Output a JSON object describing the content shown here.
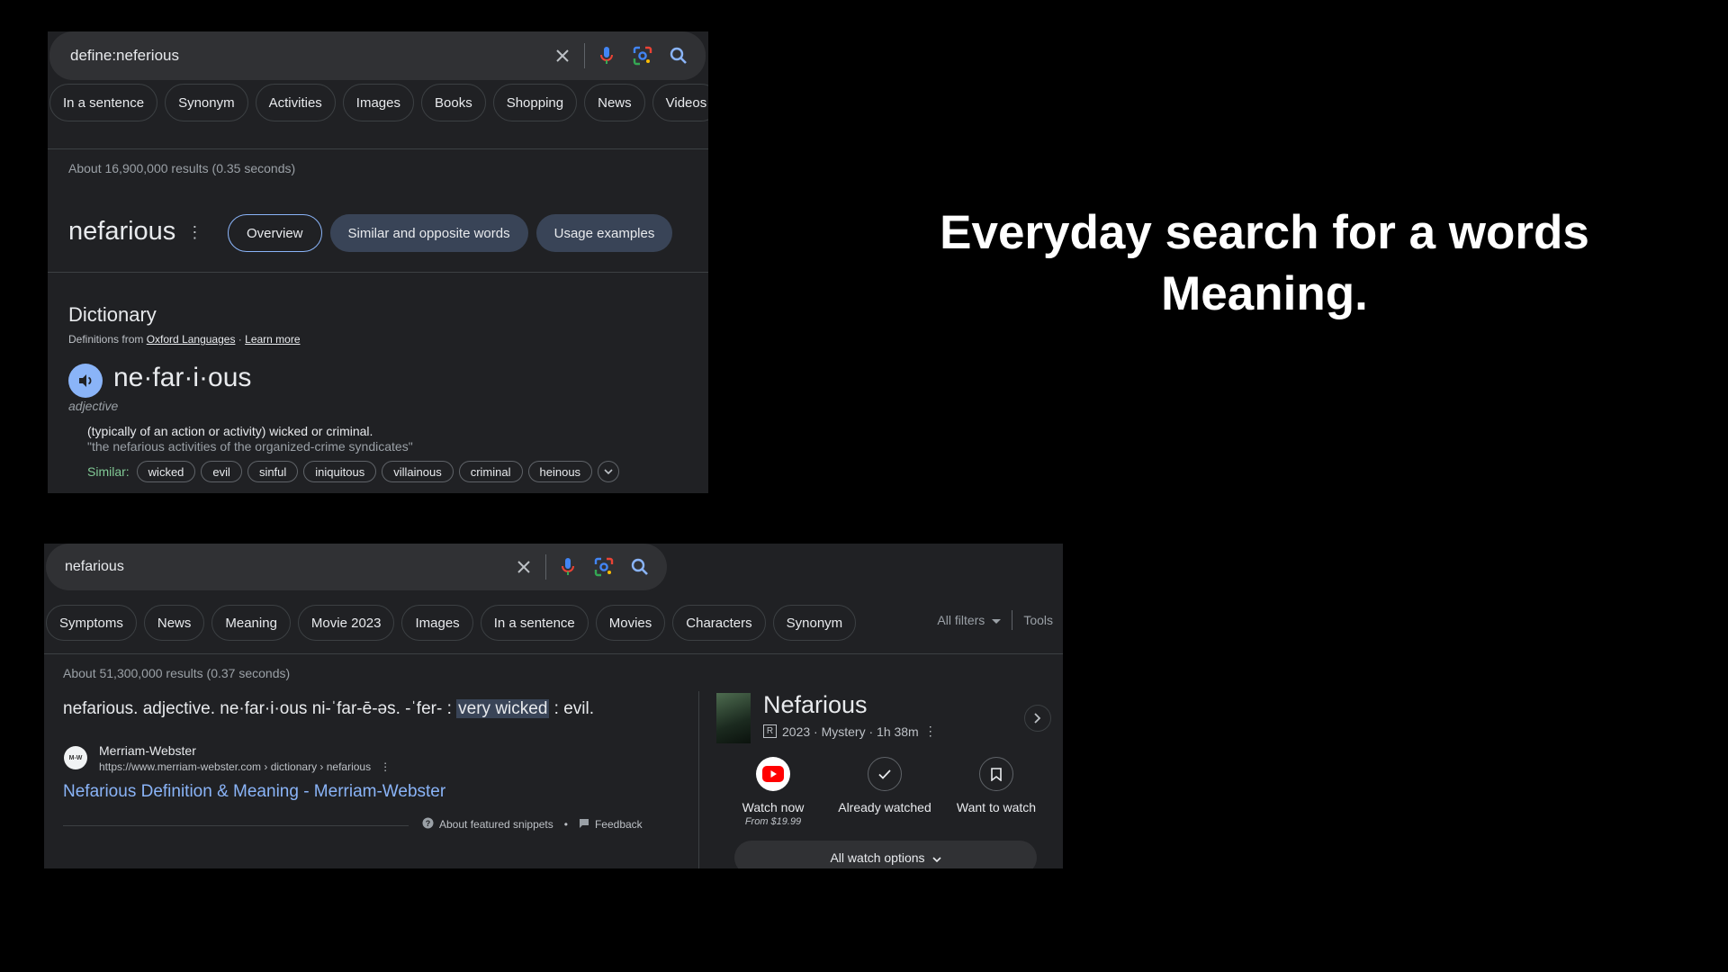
{
  "headline": {
    "line1": "Everyday search for a words",
    "line2": "Meaning."
  },
  "panel1": {
    "query": "define:neferious",
    "chips": [
      "In a sentence",
      "Synonym",
      "Activities",
      "Images",
      "Books",
      "Shopping",
      "News",
      "Videos"
    ],
    "stats": "About 16,900,000 results (0.35 seconds)",
    "word": "nefarious",
    "tabs": [
      "Overview",
      "Similar and opposite words",
      "Usage examples"
    ],
    "dictionary": {
      "title": "Dictionary",
      "source_prefix": "Definitions from",
      "source_link": "Oxford Languages",
      "source_sep": " · ",
      "learn_more": "Learn more",
      "phonetic": "ne·far·i·ous",
      "part_of_speech": "adjective",
      "definition": "(typically of an action or activity) wicked or criminal.",
      "example": "\"the nefarious activities of the organized-crime syndicates\"",
      "similar_label": "Similar:",
      "similar": [
        "wicked",
        "evil",
        "sinful",
        "iniquitous",
        "villainous",
        "criminal",
        "heinous"
      ]
    }
  },
  "panel2": {
    "query": "nefarious",
    "chips": [
      "Symptoms",
      "News",
      "Meaning",
      "Movie 2023",
      "Images",
      "In a sentence",
      "Movies",
      "Characters",
      "Synonym"
    ],
    "all_filters": "All filters",
    "tools": "Tools",
    "stats": "About 51,300,000 results (0.37 seconds)",
    "snippet": {
      "before": "nefarious. adjective. ne·far·i·ous ni-ˈfar-ē-əs. -ˈfer- : ",
      "highlight": "very wicked",
      "after": " : evil."
    },
    "favicon_text": "M-W",
    "site_name": "Merriam-Webster",
    "site_url": "https://www.merriam-webster.com › dictionary › nefarious",
    "result_title": "Nefarious Definition & Meaning - Merriam-Webster",
    "about_snippets": "About featured snippets",
    "dot": "•",
    "feedback": "Feedback",
    "movie": {
      "title": "Nefarious",
      "rating": "R",
      "meta": "2023 · Mystery · 1h 38m",
      "options": [
        {
          "label": "Watch now",
          "sub": "From $19.99"
        },
        {
          "label": "Already watched",
          "sub": ""
        },
        {
          "label": "Want to watch",
          "sub": ""
        }
      ],
      "all_watch": "All watch options"
    }
  },
  "colors": {
    "panel_bg": "#202124",
    "accent_blue": "#8ab4f8",
    "similar_green": "#81c995",
    "youtube_red": "#ff0000"
  }
}
